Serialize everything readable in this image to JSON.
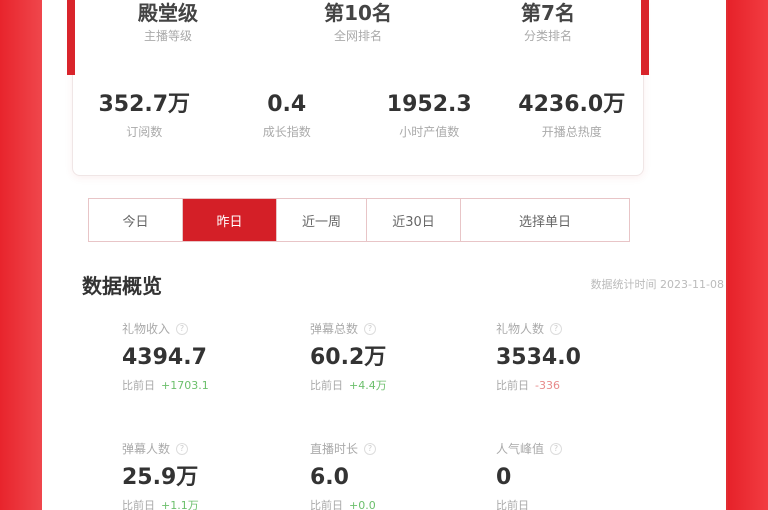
{
  "rank_card": {
    "ranks": [
      {
        "value": "殿堂级",
        "label": "主播等级"
      },
      {
        "value": "第10名",
        "label": "全网排名"
      },
      {
        "value": "第7名",
        "label": "分类排名"
      }
    ],
    "stats": [
      {
        "value": "352.7万",
        "label": "订阅数"
      },
      {
        "value": "0.4",
        "label": "成长指数"
      },
      {
        "value": "1952.3",
        "label": "小时产值数"
      },
      {
        "value": "4236.0万",
        "label": "开播总热度"
      }
    ]
  },
  "tabs": [
    {
      "label": "今日",
      "active": false
    },
    {
      "label": "昨日",
      "active": true
    },
    {
      "label": "近一周",
      "active": false
    },
    {
      "label": "近30日",
      "active": false
    },
    {
      "label": "选择单日",
      "active": false
    }
  ],
  "overview": {
    "title": "数据概览",
    "updated": "数据统计时间 2023-11-08",
    "metrics": [
      {
        "label": "礼物收入",
        "value": "4394.7",
        "compare_label": "比前日",
        "delta": "+1703.1",
        "trend": "up"
      },
      {
        "label": "弹幕总数",
        "value": "60.2万",
        "compare_label": "比前日",
        "delta": "+4.4万",
        "trend": "up"
      },
      {
        "label": "礼物人数",
        "value": "3534.0",
        "compare_label": "比前日",
        "delta": "-336",
        "trend": "down"
      },
      {
        "label": "弹幕人数",
        "value": "25.9万",
        "compare_label": "比前日",
        "delta": "+1.1万",
        "trend": "up"
      },
      {
        "label": "直播时长",
        "value": "6.0",
        "compare_label": "比前日",
        "delta": "+0.0",
        "trend": "up"
      },
      {
        "label": "人气峰值",
        "value": "0",
        "compare_label": "比前日",
        "delta": "",
        "trend": "up"
      }
    ]
  },
  "colors": {
    "accent": "#d41f27",
    "up": "#6cbf6c",
    "down": "#e88a8a"
  }
}
